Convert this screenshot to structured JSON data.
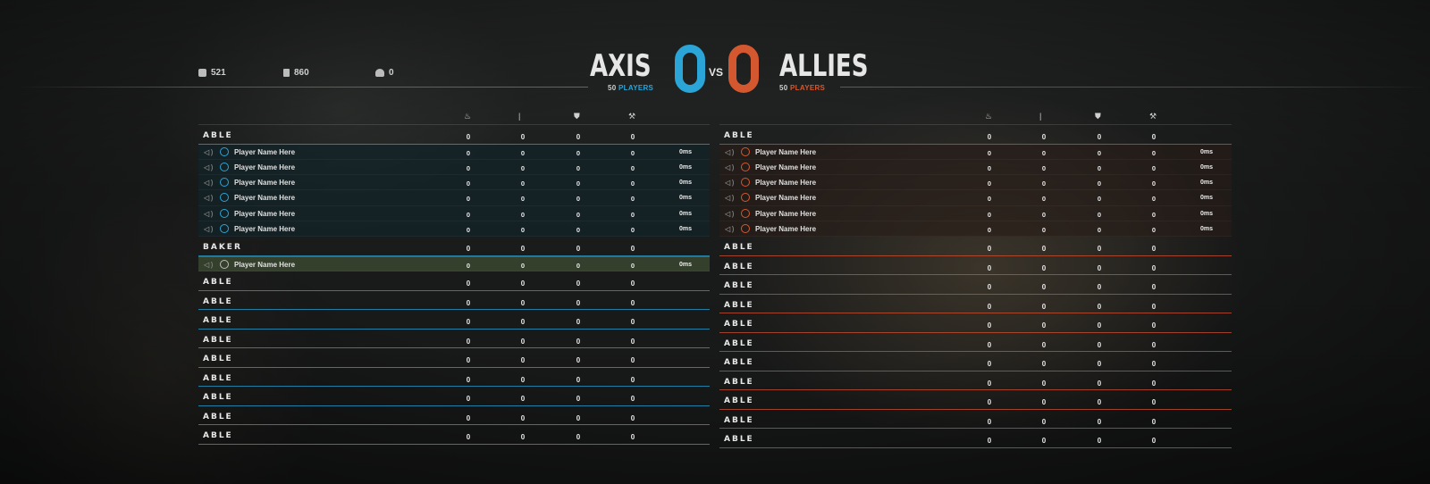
{
  "header": {
    "stats": [
      {
        "icon": "supplies-icon",
        "value": "521"
      },
      {
        "icon": "fuel-icon",
        "value": "860"
      },
      {
        "icon": "players-icon",
        "value": "0"
      }
    ],
    "axis": {
      "name": "AXIS",
      "score": "0",
      "players_count": "50",
      "players_label": "PLAYERS",
      "color": "#2ba5d8"
    },
    "vs": "VS",
    "allies": {
      "name": "ALLIES",
      "score": "0",
      "players_count": "50",
      "players_label": "PLAYERS",
      "color": "#d4582f"
    }
  },
  "columns": {
    "icons": [
      "combat-icon",
      "offense-icon",
      "defense-icon",
      "support-icon"
    ]
  },
  "axis_panel": {
    "groups": [
      {
        "name": "ABLE",
        "values": [
          "0",
          "0",
          "0",
          "0"
        ],
        "players": [
          {
            "name": "Player Name Here",
            "values": [
              "0",
              "0",
              "0",
              "0"
            ],
            "ping": "0ms"
          },
          {
            "name": "Player Name Here",
            "values": [
              "0",
              "0",
              "0",
              "0"
            ],
            "ping": "0ms"
          },
          {
            "name": "Player Name Here",
            "values": [
              "0",
              "0",
              "0",
              "0"
            ],
            "ping": "0ms"
          },
          {
            "name": "Player Name Here",
            "values": [
              "0",
              "0",
              "0",
              "0"
            ],
            "ping": "0ms"
          },
          {
            "name": "Player Name Here",
            "values": [
              "0",
              "0",
              "0",
              "0"
            ],
            "ping": "0ms"
          },
          {
            "name": "Player Name Here",
            "values": [
              "0",
              "0",
              "0",
              "0"
            ],
            "ping": "0ms"
          }
        ]
      },
      {
        "name": "BAKER",
        "values": [
          "0",
          "0",
          "0",
          "0"
        ],
        "highlight": true,
        "players": [
          {
            "name": "Player Name Here",
            "values": [
              "0",
              "0",
              "0",
              "0"
            ],
            "ping": "0ms"
          }
        ]
      },
      {
        "name": "ABLE",
        "values": [
          "0",
          "0",
          "0",
          "0"
        ],
        "players": []
      },
      {
        "name": "ABLE",
        "values": [
          "0",
          "0",
          "0",
          "0"
        ],
        "players": []
      },
      {
        "name": "ABLE",
        "values": [
          "0",
          "0",
          "0",
          "0"
        ],
        "players": []
      },
      {
        "name": "ABLE",
        "values": [
          "0",
          "0",
          "0",
          "0"
        ],
        "players": []
      },
      {
        "name": "ABLE",
        "values": [
          "0",
          "0",
          "0",
          "0"
        ],
        "players": []
      },
      {
        "name": "ABLE",
        "values": [
          "0",
          "0",
          "0",
          "0"
        ],
        "players": []
      },
      {
        "name": "ABLE",
        "values": [
          "0",
          "0",
          "0",
          "0"
        ],
        "players": []
      },
      {
        "name": "ABLE",
        "values": [
          "0",
          "0",
          "0",
          "0"
        ],
        "players": []
      },
      {
        "name": "ABLE",
        "values": [
          "0",
          "0",
          "0",
          "0"
        ],
        "players": []
      }
    ]
  },
  "allies_panel": {
    "groups": [
      {
        "name": "ABLE",
        "values": [
          "0",
          "0",
          "0",
          "0"
        ],
        "players": [
          {
            "name": "Player Name Here",
            "values": [
              "0",
              "0",
              "0",
              "0"
            ],
            "ping": "0ms"
          },
          {
            "name": "Player Name Here",
            "values": [
              "0",
              "0",
              "0",
              "0"
            ],
            "ping": "0ms"
          },
          {
            "name": "Player Name Here",
            "values": [
              "0",
              "0",
              "0",
              "0"
            ],
            "ping": "0ms"
          },
          {
            "name": "Player Name Here",
            "values": [
              "0",
              "0",
              "0",
              "0"
            ],
            "ping": "0ms"
          },
          {
            "name": "Player Name Here",
            "values": [
              "0",
              "0",
              "0",
              "0"
            ],
            "ping": "0ms"
          },
          {
            "name": "Player Name Here",
            "values": [
              "0",
              "0",
              "0",
              "0"
            ],
            "ping": "0ms"
          }
        ]
      },
      {
        "name": "ABLE",
        "values": [
          "0",
          "0",
          "0",
          "0"
        ],
        "players": []
      },
      {
        "name": "ABLE",
        "values": [
          "0",
          "0",
          "0",
          "0"
        ],
        "players": []
      },
      {
        "name": "ABLE",
        "values": [
          "0",
          "0",
          "0",
          "0"
        ],
        "players": []
      },
      {
        "name": "ABLE",
        "values": [
          "0",
          "0",
          "0",
          "0"
        ],
        "players": []
      },
      {
        "name": "ABLE",
        "values": [
          "0",
          "0",
          "0",
          "0"
        ],
        "players": []
      },
      {
        "name": "ABLE",
        "values": [
          "0",
          "0",
          "0",
          "0"
        ],
        "players": []
      },
      {
        "name": "ABLE",
        "values": [
          "0",
          "0",
          "0",
          "0"
        ],
        "players": []
      },
      {
        "name": "ABLE",
        "values": [
          "0",
          "0",
          "0",
          "0"
        ],
        "players": []
      },
      {
        "name": "ABLE",
        "values": [
          "0",
          "0",
          "0",
          "0"
        ],
        "players": []
      },
      {
        "name": "ABLE",
        "values": [
          "0",
          "0",
          "0",
          "0"
        ],
        "players": []
      },
      {
        "name": "ABLE",
        "values": [
          "0",
          "0",
          "0",
          "0"
        ],
        "players": []
      }
    ]
  }
}
